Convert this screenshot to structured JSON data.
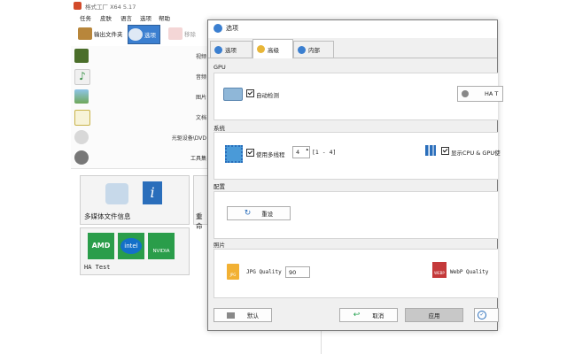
{
  "app": {
    "title": "格式工厂 X64 5.17",
    "menu": [
      "任务",
      "皮肤",
      "语言",
      "选项",
      "帮助"
    ],
    "toolbar": {
      "output_folder": "输出文件夹",
      "options": "选项",
      "remove": "移除"
    },
    "categories": [
      "视频",
      "音频",
      "图片",
      "文档",
      "光驱设备\\DVD",
      "工具集"
    ],
    "tiles": {
      "media_info": "多媒体文件信息",
      "rename": "重命",
      "ha_test": "HA Test"
    }
  },
  "dialog": {
    "title": "选项",
    "tabs": [
      "选项",
      "高级",
      "内部"
    ],
    "active_tab": "高级",
    "sections": {
      "gpu": {
        "title": "GPU",
        "autodetect": "自动检测",
        "ha_test_button": "HA T"
      },
      "system": {
        "title": "系统",
        "multithread": "使用多线程",
        "thread_value": "4",
        "thread_range": "[1 - 4]",
        "show_usage": "显示CPU & GPU使"
      },
      "config": {
        "title": "配置",
        "reset": "重设"
      },
      "image": {
        "title": "照片",
        "jpg_quality": "JPG Quality",
        "jpg_value": "90",
        "webp_quality": "WebP Quality"
      }
    },
    "footer": {
      "default": "默认",
      "cancel": "取消",
      "apply": "应用"
    }
  },
  "colors": {
    "accent": "#2a6ebb",
    "green": "#1e9e4a",
    "amd": "#3a3a3a",
    "intel": "#1470c8",
    "nvidia": "#76b900"
  }
}
